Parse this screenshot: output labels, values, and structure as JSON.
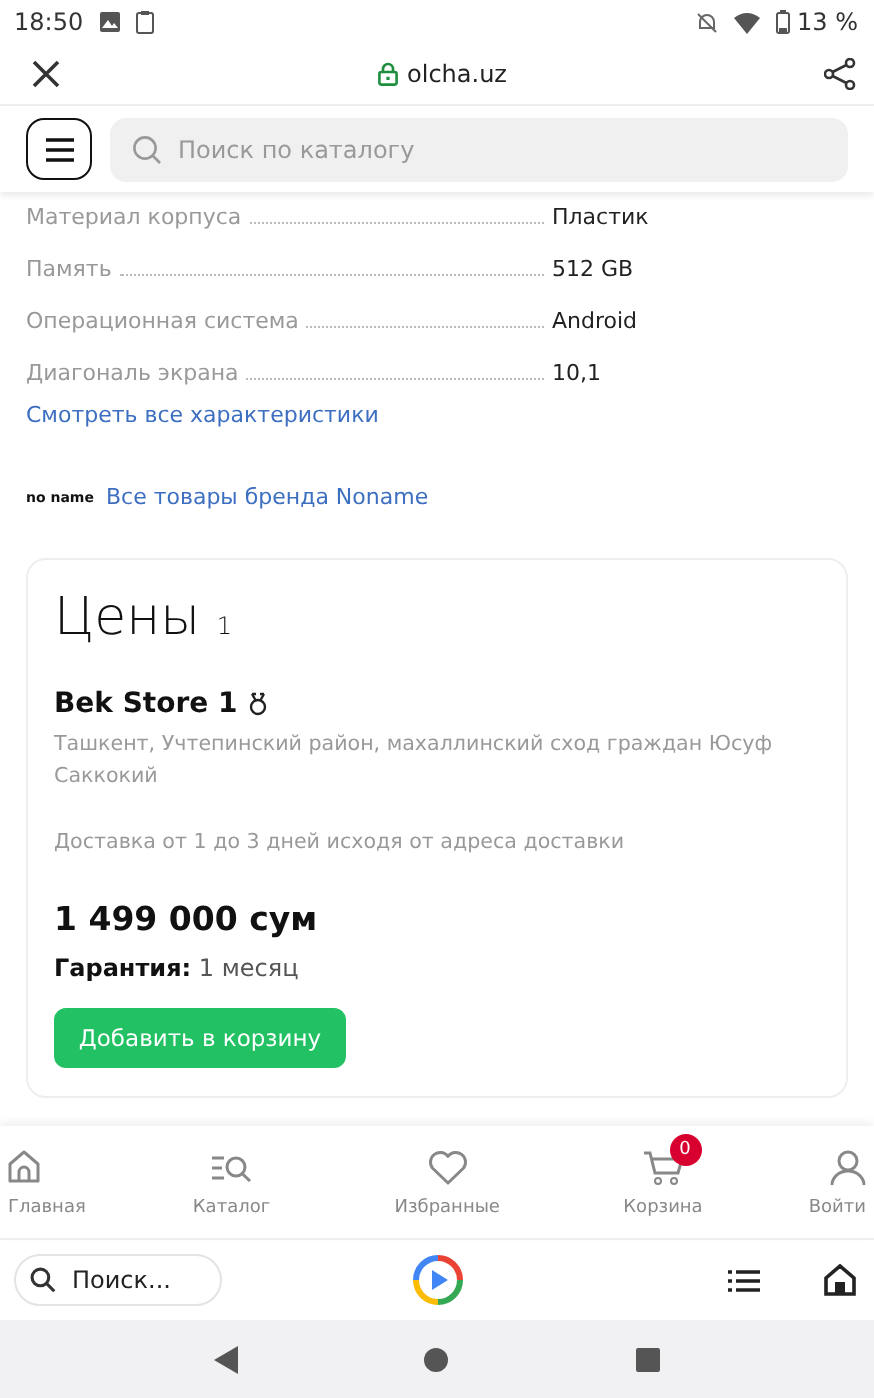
{
  "status_bar": {
    "time": "18:50",
    "battery": "13 %"
  },
  "browser": {
    "url": "olcha.uz"
  },
  "header": {
    "search": {
      "placeholder": "Поиск по каталогу"
    }
  },
  "specs": [
    {
      "name": "Материал корпуса",
      "value": "Пластик"
    },
    {
      "name": "Память",
      "value": "512 GB"
    },
    {
      "name": "Операционная система",
      "value": "Android"
    },
    {
      "name": "Диагональ экрана",
      "value": "10,1"
    }
  ],
  "all_specs_link": "Смотреть все характеристики",
  "brand": {
    "logo": "no name",
    "link": "Все товары бренда Noname"
  },
  "prices": {
    "title": "Цены",
    "count": "1",
    "store": "Bek Store 1",
    "address": "Ташкент, Учтепинский район, махаллинский сход граждан Юсуф Саккокий",
    "delivery": "Доставка от 1 до 3 дней исходя от адреса доставки",
    "price": "1 499 000 сум",
    "warranty_label": "Гарантия:",
    "warranty": "1 месяц",
    "button": "Добавить в корзину"
  },
  "bottom_nav": [
    {
      "kind": "home",
      "label": "Главная"
    },
    {
      "kind": "catalog",
      "label": "Каталог"
    },
    {
      "kind": "favorites",
      "label": "Избранные"
    },
    {
      "kind": "cart",
      "label": "Корзина",
      "badge": "0"
    },
    {
      "kind": "user",
      "label": "Войти"
    }
  ],
  "browser_bar": {
    "search": {
      "placeholder": "Поиск..."
    }
  }
}
